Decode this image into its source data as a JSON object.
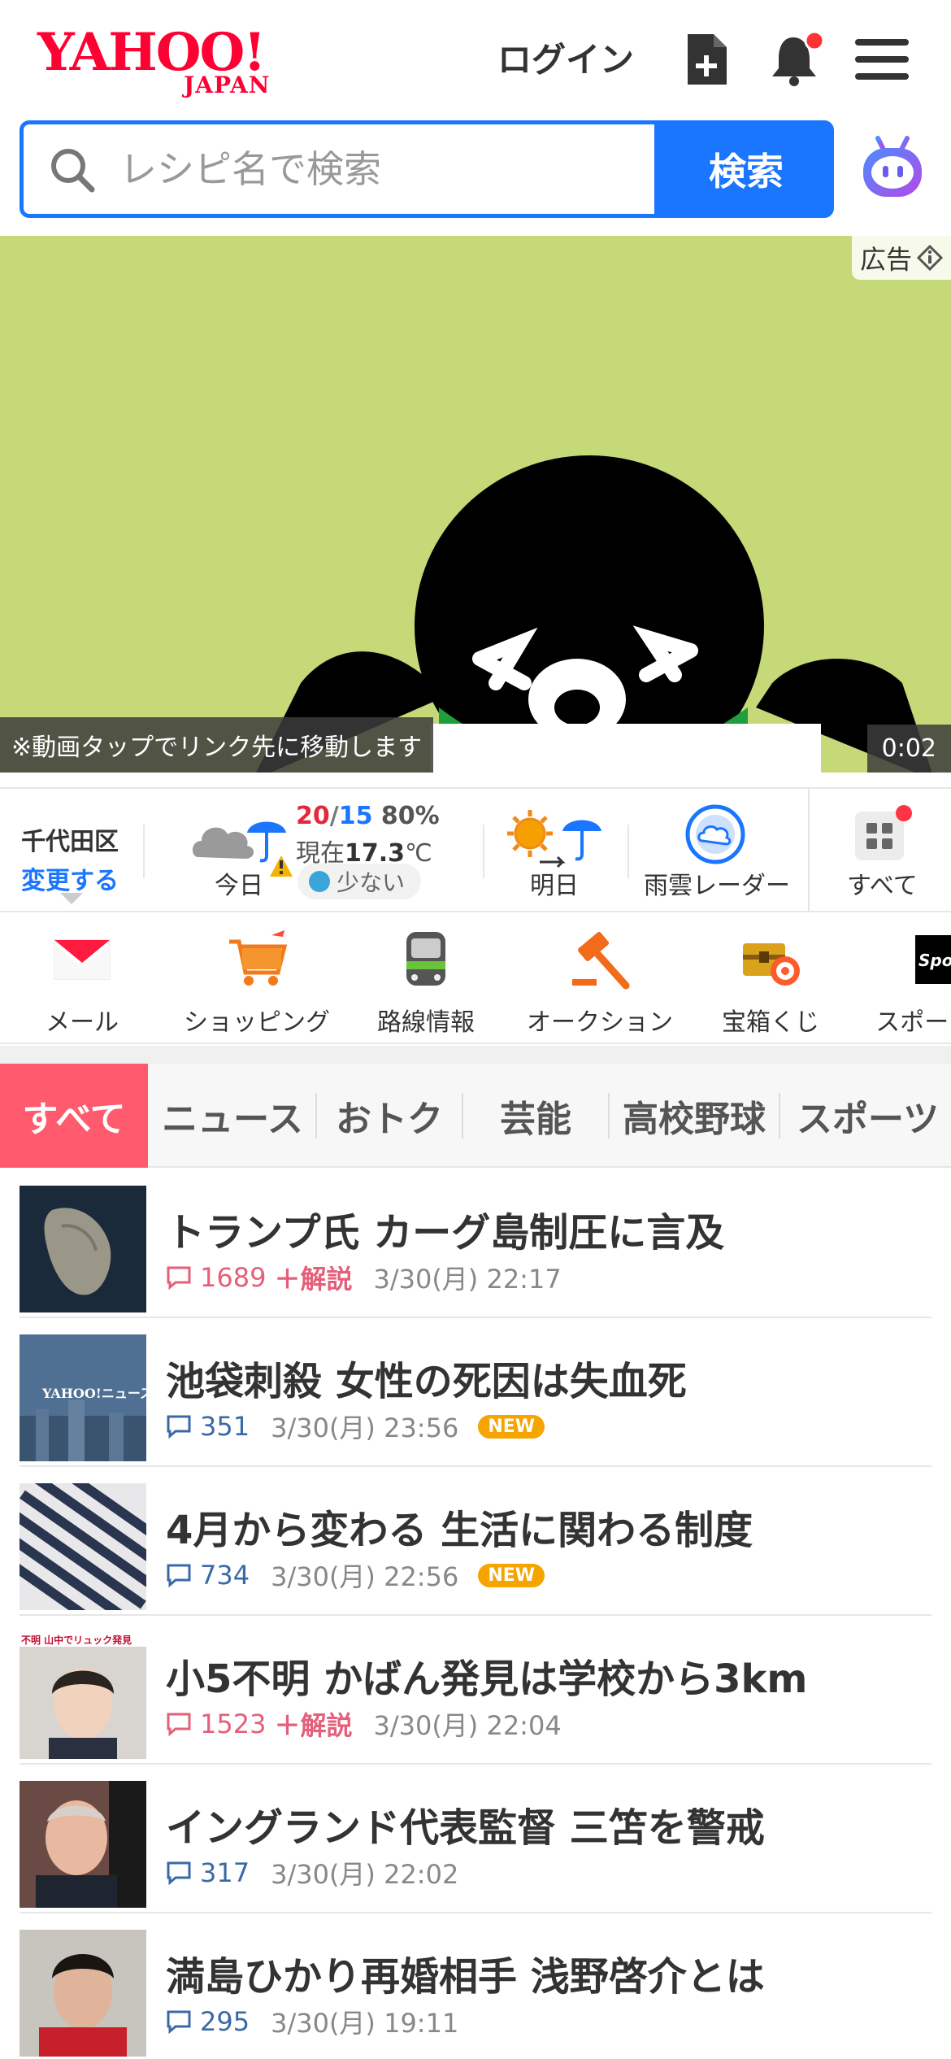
{
  "header": {
    "logo_main": "YAHOO!",
    "logo_sub": "JAPAN",
    "login_label": "ログイン"
  },
  "search": {
    "placeholder": "レシピ名で検索",
    "button_label": "検索"
  },
  "ad": {
    "label": "広告",
    "caption": "※動画タップでリンク先に移動します",
    "time": "0:02"
  },
  "weather": {
    "location": "千代田区",
    "change_label": "変更する",
    "high": "20",
    "sep": "/",
    "low": "15",
    "precip": "80%",
    "current_prefix": "現在",
    "current_temp": "17.3",
    "current_unit": "℃",
    "pollen": "少ない",
    "today_label": "今日",
    "tomorrow_label": "明日",
    "radar_label": "雨雲レーダー",
    "all_label": "すべて"
  },
  "services": [
    {
      "label": "メール"
    },
    {
      "label": "ショッピング"
    },
    {
      "label": "路線情報"
    },
    {
      "label": "オークション"
    },
    {
      "label": "宝箱くじ"
    },
    {
      "label": "スポーツ"
    }
  ],
  "tabs": [
    {
      "label": "すべて"
    },
    {
      "label": "ニュース"
    },
    {
      "label": "おトク"
    },
    {
      "label": "芸能"
    },
    {
      "label": "高校野球"
    },
    {
      "label": "スポーツ"
    }
  ],
  "news": [
    {
      "title": "トランプ氏 カーグ島制圧に言及",
      "comments": "1689",
      "explain": "＋解説",
      "time": "3/30(月) 22:17",
      "badge": ""
    },
    {
      "title": "池袋刺殺 女性の死因は失血死",
      "comments": "351",
      "explain": "",
      "time": "3/30(月) 23:56",
      "badge": "NEW"
    },
    {
      "title": "4月から変わる 生活に関わる制度",
      "comments": "734",
      "explain": "",
      "time": "3/30(月) 22:56",
      "badge": "NEW"
    },
    {
      "title": "小5不明 かばん発見は学校から3km",
      "comments": "1523",
      "explain": "＋解説",
      "time": "3/30(月) 22:04",
      "badge": ""
    },
    {
      "title": "イングランド代表監督 三笘を警戒",
      "comments": "317",
      "explain": "",
      "time": "3/30(月) 22:02",
      "badge": ""
    },
    {
      "title": "満島ひかり再婚相手 浅野啓介とは",
      "comments": "295",
      "explain": "",
      "time": "3/30(月) 19:11",
      "badge": ""
    }
  ],
  "thumb_texts": {
    "yahoo_news": "YAHOO!ニュース",
    "missing_banner": "不明 山中でリュック発見",
    "sports_logo": "Sports"
  },
  "colors": {
    "brand_red": "#ff0033",
    "accent_blue": "#1a75ff",
    "tab_active": "#ff5a6e",
    "new_badge": "#f5a400"
  }
}
